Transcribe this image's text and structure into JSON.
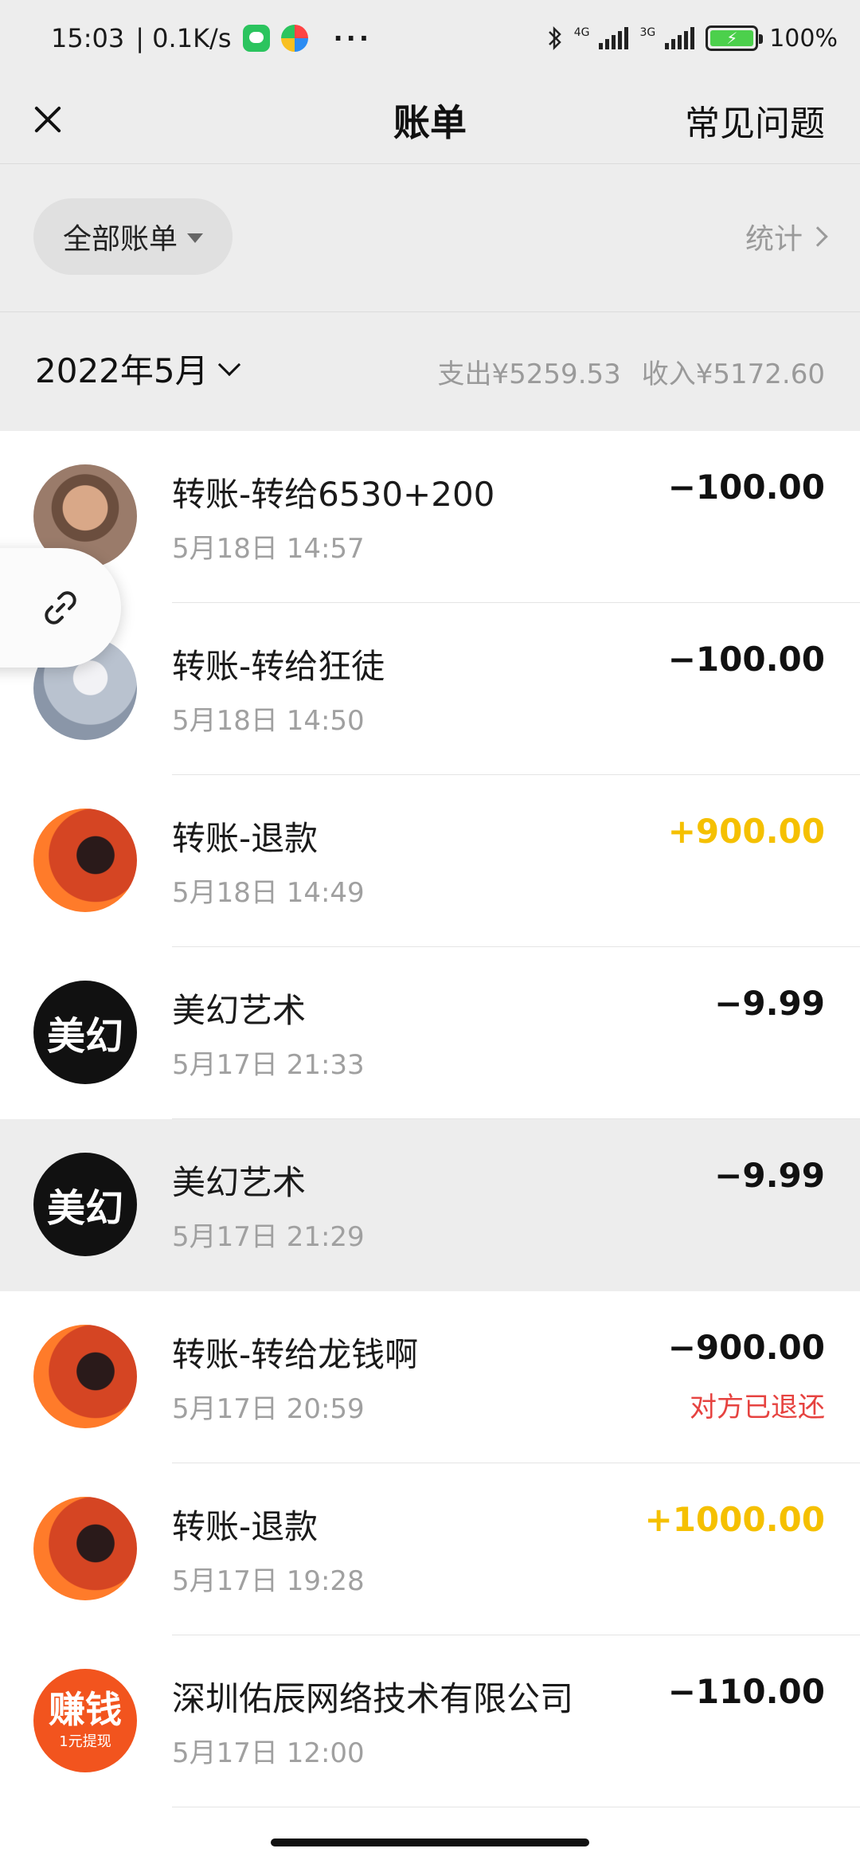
{
  "statusbar": {
    "time": "15:03",
    "net_speed": "| 0.1K/s",
    "more": "···",
    "net1": "4G",
    "net2": "3G",
    "battery": "100%"
  },
  "nav": {
    "title": "账单",
    "faq": "常见问题"
  },
  "filter": {
    "label": "全部账单",
    "stats": "统计"
  },
  "month": {
    "label": "2022年5月",
    "expense": "支出¥5259.53",
    "income": "收入¥5172.60"
  },
  "transactions": [
    {
      "title": "转账-转给6530+200",
      "date": "5月18日 14:57",
      "amount": "−100.00",
      "type": "expense",
      "avatar": "photo-face"
    },
    {
      "title": "转账-转给狂徒",
      "date": "5月18日 14:50",
      "amount": "−100.00",
      "type": "expense",
      "avatar": "photo-snow"
    },
    {
      "title": "转账-退款",
      "date": "5月18日 14:49",
      "amount": "+900.00",
      "type": "income",
      "avatar": "photo-red"
    },
    {
      "title": "美幻艺术",
      "date": "5月17日 21:33",
      "amount": "−9.99",
      "type": "expense",
      "avatar_text": "美幻"
    },
    {
      "title": "美幻艺术",
      "date": "5月17日 21:29",
      "amount": "−9.99",
      "type": "expense",
      "avatar_text": "美幻"
    },
    {
      "title": "转账-转给龙钱啊",
      "date": "5月17日 20:59",
      "amount": "−900.00",
      "type": "expense",
      "note": "对方已退还",
      "avatar": "photo-red"
    },
    {
      "title": "转账-退款",
      "date": "5月17日 19:28",
      "amount": "+1000.00",
      "type": "income",
      "avatar": "photo-red"
    },
    {
      "title": "深圳佑辰网络技术有限公司",
      "date": "5月17日 12:00",
      "amount": "−110.00",
      "type": "expense",
      "avatar_text": "赚钱",
      "avatar_sub": "1元提现"
    }
  ],
  "colors": {
    "income": "#f5c000",
    "refund_note": "#e64340",
    "background": "#ededed"
  }
}
